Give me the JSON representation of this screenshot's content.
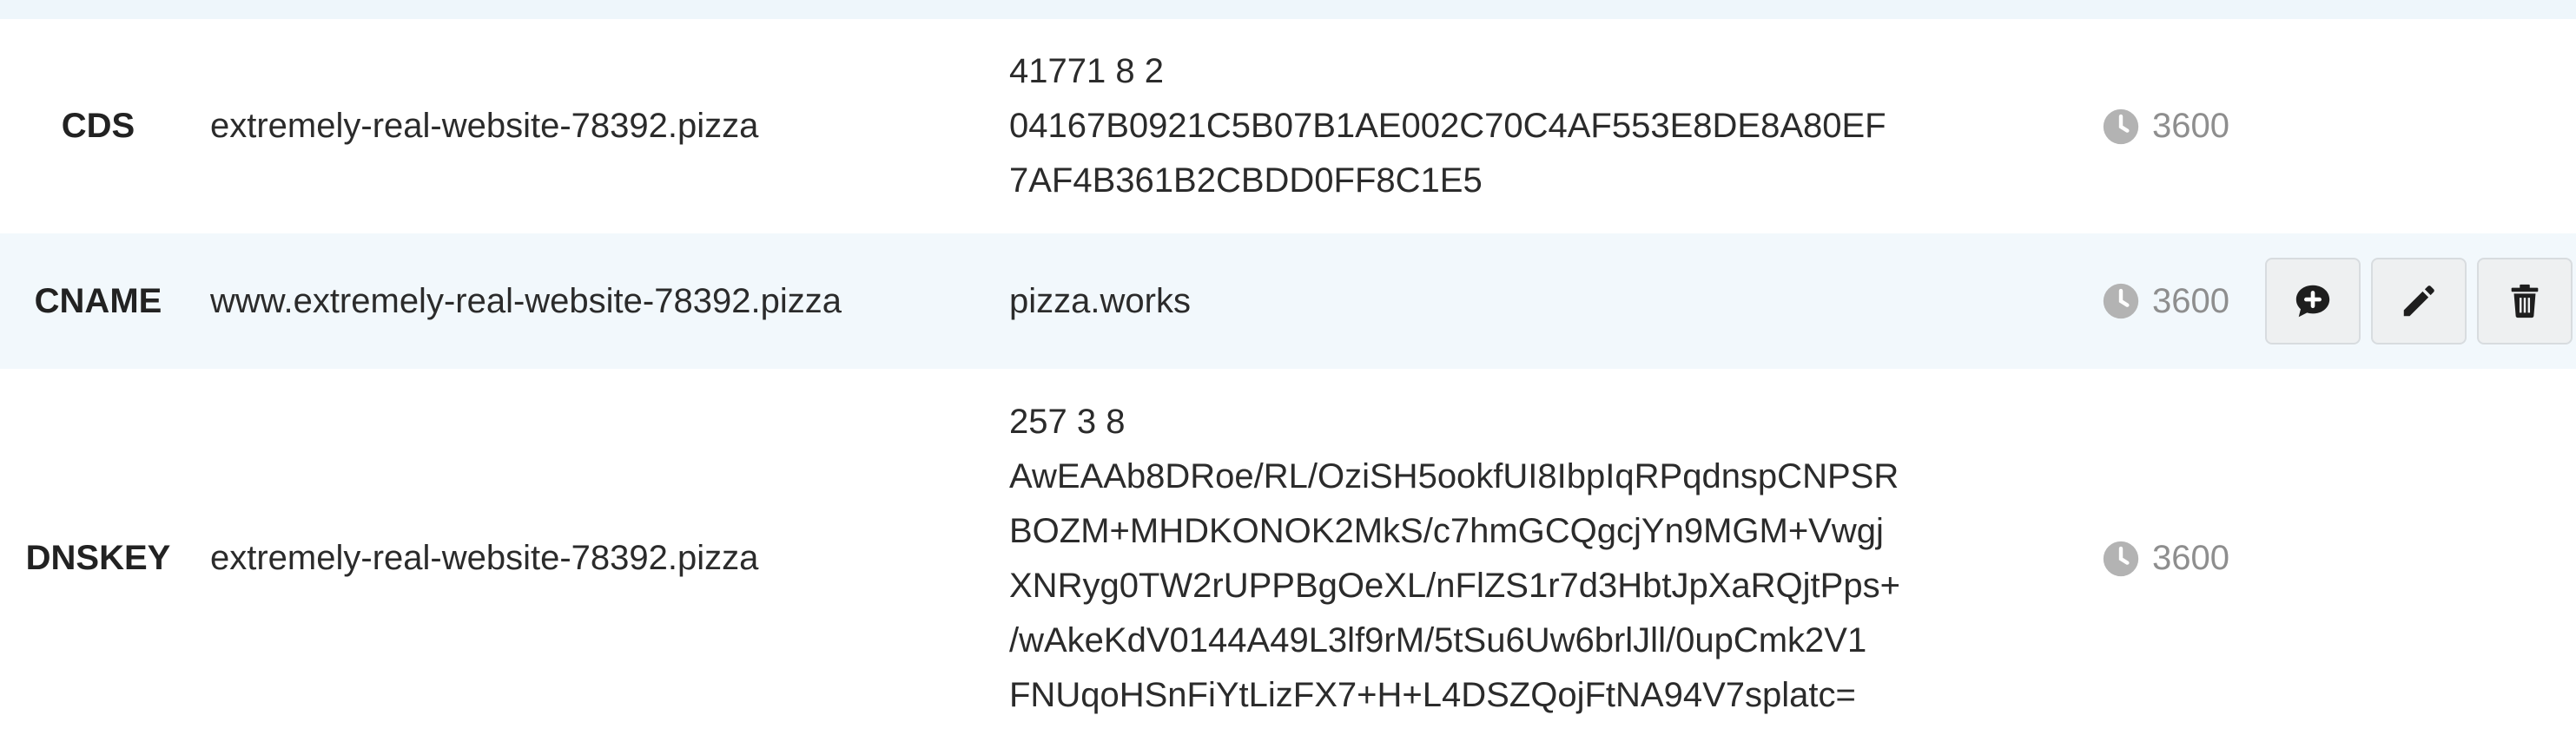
{
  "records": [
    {
      "type": "CDS",
      "name": "extremely-real-website-78392.pizza",
      "content": [
        "41771 8 2",
        "04167B0921C5B07B1AE002C70C4AF553E8DE8A80EF",
        "7AF4B361B2CBDD0FF8C1E5"
      ],
      "ttl": "3600"
    },
    {
      "type": "CNAME",
      "name": "www.extremely-real-website-78392.pizza",
      "content": [
        "pizza.works"
      ],
      "ttl": "3600",
      "actions": [
        {
          "icon": "comment-plus-icon"
        },
        {
          "icon": "pencil-icon"
        },
        {
          "icon": "trash-icon"
        }
      ]
    },
    {
      "type": "DNSKEY",
      "name": "extremely-real-website-78392.pizza",
      "content": [
        "257 3 8",
        "AwEAAb8DRoe/RL/OziSH5ookfUI8IbpIqRPqdnspCNPSR",
        "BOZM+MHDKONOK2MkS/c7hmGCQgcjYn9MGM+Vwgj",
        "XNRyg0TW2rUPPBgOeXL/nFlZS1r7d3HbtJpXaRQjtPps+",
        "/wAkeKdV0144A49L3lf9rM/5tSu6Uw6brlJll/0upCmk2V1",
        "FNUqoHSnFiYtLizFX7+H+L4DSZQojFtNA94V7splatc="
      ],
      "ttl": "3600"
    }
  ],
  "colors": {
    "highlight_row": "#f2f8fc",
    "ttl_text": "#8e8e8e",
    "button_bg": "#eef0f1"
  }
}
